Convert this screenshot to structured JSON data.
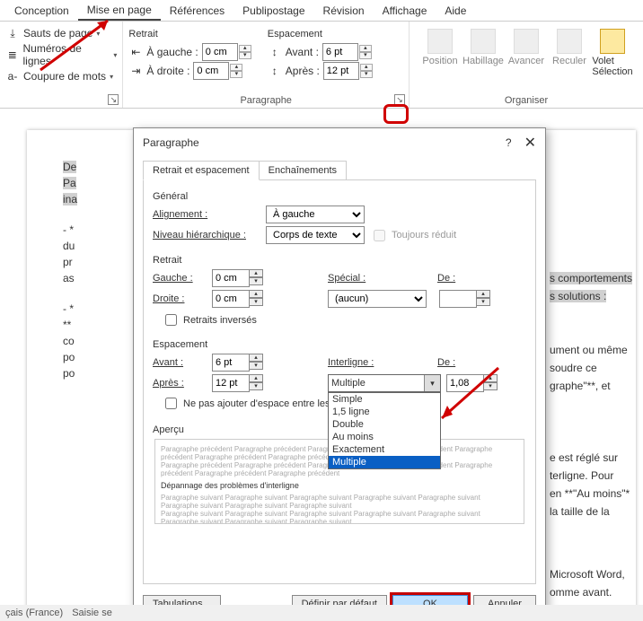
{
  "ribbon": {
    "tabs": [
      "Conception",
      "Mise en page",
      "Références",
      "Publipostage",
      "Révision",
      "Affichage",
      "Aide"
    ],
    "active_tab": "Mise en page",
    "page_setup": {
      "breaks": "Sauts de page",
      "line_numbers": "Numéros de lignes",
      "hyphenation": "Coupure de mots"
    },
    "paragraph": {
      "title": "Paragraphe",
      "indent_title": "Retrait",
      "spacing_title": "Espacement",
      "left_label": "À gauche :",
      "right_label": "À droite :",
      "before_label": "Avant :",
      "after_label": "Après :",
      "left_val": "0 cm",
      "right_val": "0 cm",
      "before_val": "6 pt",
      "after_val": "12 pt"
    },
    "arrange": {
      "title": "Organiser",
      "position": "Position",
      "wrap": "Habillage",
      "forward": "Avancer",
      "backward": "Reculer",
      "selection": "Volet Sélection"
    }
  },
  "dialog": {
    "title": "Paragraphe",
    "help": "?",
    "tab1": "Retrait et espacement",
    "tab2": "Enchaînements",
    "general": {
      "title": "Général",
      "align_label": "Alignement :",
      "align_value": "À gauche",
      "outline_label": "Niveau hiérarchique :",
      "outline_value": "Corps de texte",
      "collapsed": "Toujours réduit"
    },
    "indent": {
      "title": "Retrait",
      "left_label": "Gauche :",
      "left_val": "0 cm",
      "right_label": "Droite :",
      "right_val": "0 cm",
      "special_label": "Spécial :",
      "special_val": "(aucun)",
      "by_label": "De :",
      "by_val": "",
      "mirror": "Retraits inversés"
    },
    "spacing": {
      "title": "Espacement",
      "before_label": "Avant :",
      "before_val": "6 pt",
      "after_label": "Après :",
      "after_val": "12 pt",
      "line_label": "Interligne :",
      "line_val": "Multiple",
      "at_label": "De :",
      "at_val": "1,08",
      "no_space": "Ne pas ajouter d'espace entre les paragraph",
      "options": [
        "Simple",
        "1,5 ligne",
        "Double",
        "Au moins",
        "Exactement",
        "Multiple"
      ]
    },
    "preview": {
      "title": "Aperçu",
      "before_text": "Paragraphe précédent Paragraphe précédent Paragraphe précédent Paragraphe précédent Paragraphe précédent Paragraphe précédent Paragraphe précédent",
      "sample": "Dépannage des problèmes d'interligne",
      "after_text": "Paragraphe suivant Paragraphe suivant Paragraphe suivant Paragraphe suivant Paragraphe suivant Paragraphe suivant Paragraphe suivant Paragraphe suivant"
    },
    "buttons": {
      "tabs": "Tabulations...",
      "default": "Définir par défaut",
      "ok": "OK",
      "cancel": "Annuler"
    }
  },
  "doc": {
    "t0": "De",
    "t1": "Pa",
    "t2": "ina",
    "r1": "s comportements",
    "r2": "s solutions :",
    "r3": "ument ou même",
    "r4": "soudre ce",
    "r5": "graphe\"**, et",
    "r6": "e est réglé sur",
    "r7": "terligne. Pour",
    "r8": "en **\"Au moins\"*",
    "r9": "la taille de la",
    "r10": "Microsoft Word,",
    "r11": "omme avant."
  },
  "status": {
    "lang": "çais (France)",
    "save": "Saisie se"
  }
}
